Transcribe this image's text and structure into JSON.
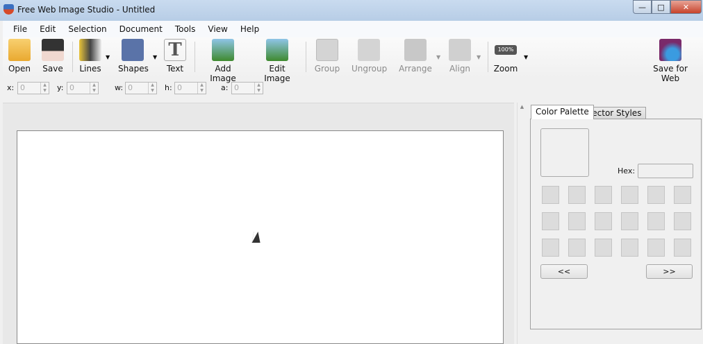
{
  "window": {
    "title": "Free Web Image Studio - Untitled",
    "minimize": "—",
    "maximize": "□",
    "close": "✕"
  },
  "menu": [
    "File",
    "Edit",
    "Selection",
    "Document",
    "Tools",
    "View",
    "Help"
  ],
  "toolbar": {
    "open": "Open",
    "save": "Save",
    "lines": "Lines",
    "shapes": "Shapes",
    "text": "Text",
    "add_image": "Add Image",
    "edit_image": "Edit Image",
    "group": "Group",
    "ungroup": "Ungroup",
    "arrange": "Arrange",
    "align": "Align",
    "zoom": "Zoom",
    "zoom_badge": "100%",
    "save_web": "Save for Web"
  },
  "props": [
    {
      "label": "x:",
      "value": "0"
    },
    {
      "label": "y:",
      "value": "0"
    },
    {
      "label": "w:",
      "value": "0"
    },
    {
      "label": "h:",
      "value": "0"
    },
    {
      "label": "a:",
      "value": "0"
    }
  ],
  "panel": {
    "tabs": [
      "Color Palette",
      "Vector Styles"
    ],
    "hex_label": "Hex:",
    "hex_value": "",
    "prev": "<<",
    "next": ">>"
  }
}
